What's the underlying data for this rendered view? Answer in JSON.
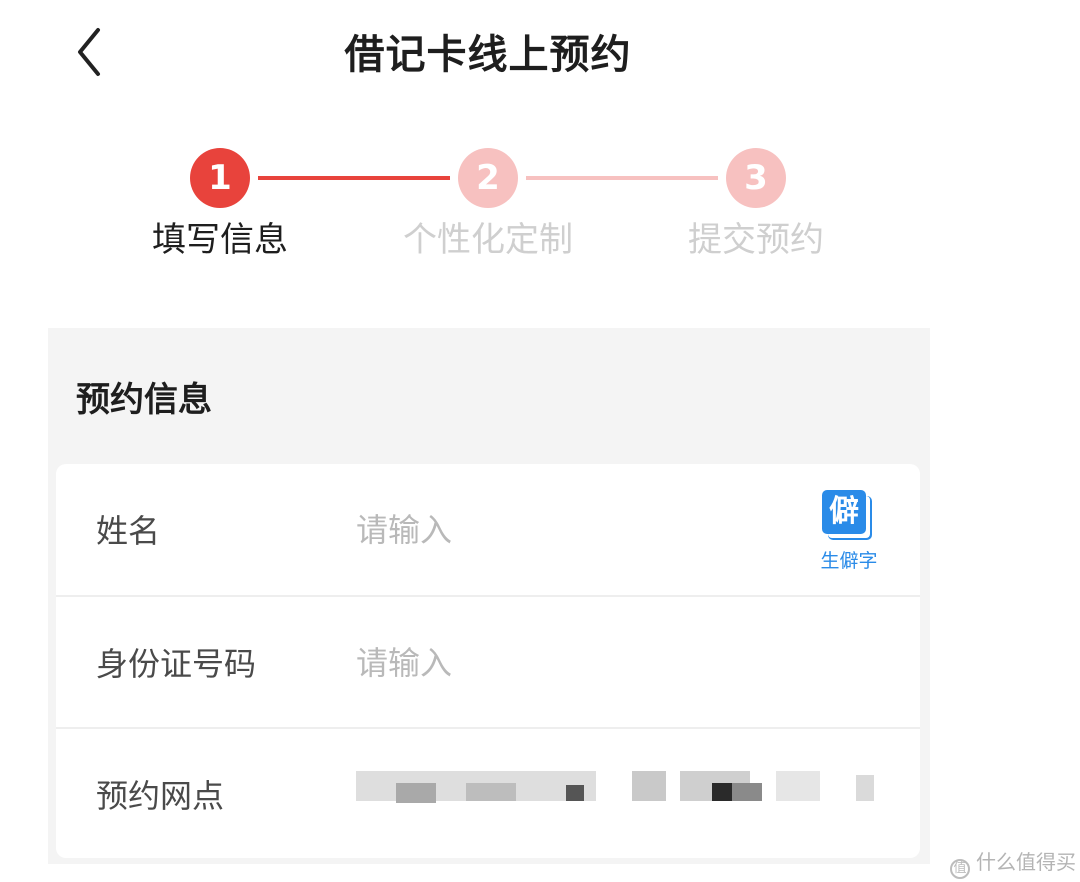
{
  "header": {
    "title": "借记卡线上预约",
    "back_icon": "chevron-left-icon"
  },
  "stepper": {
    "steps": [
      {
        "number": "1",
        "label": "填写信息",
        "state": "active"
      },
      {
        "number": "2",
        "label": "个性化定制",
        "state": "pending"
      },
      {
        "number": "3",
        "label": "提交预约",
        "state": "pending"
      }
    ]
  },
  "section": {
    "title": "预约信息"
  },
  "form": {
    "name": {
      "label": "姓名",
      "placeholder": "请输入",
      "value": ""
    },
    "rare_char_button": {
      "icon": "僻",
      "label": "生僻字"
    },
    "id_number": {
      "label": "身份证号码",
      "placeholder": "请输入",
      "value": ""
    },
    "branch": {
      "label": "预约网点",
      "value_obscured": true
    }
  },
  "watermark": {
    "text": "什么值得买",
    "icon": "值"
  },
  "colors": {
    "accent": "#e8433c",
    "accent_light": "#f7c1c0",
    "rare_blue": "#2a8be8"
  }
}
